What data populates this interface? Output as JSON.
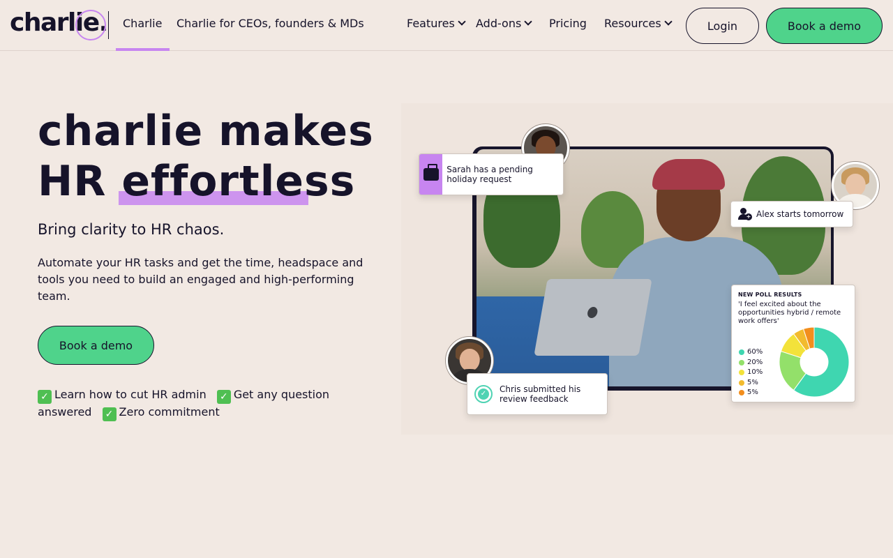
{
  "nav": {
    "logo_text": "charlie.",
    "links": {
      "charlie": "Charlie",
      "ceos": "Charlie for CEOs, founders & MDs",
      "features": "Features",
      "addons": "Add-ons",
      "pricing": "Pricing",
      "resources": "Resources"
    },
    "login_label": "Login",
    "demo_label": "Book a demo"
  },
  "hero": {
    "headline_line1": "charlie makes",
    "headline_line2_prefix": "HR ",
    "headline_line2_highlight": "effortless",
    "subtitle": "Bring clarity to HR chaos.",
    "body": "Automate your HR tasks and get the time, headspace and tools you need to build an engaged and high-performing team.",
    "cta_label": "Book a demo",
    "perks": [
      "Learn how to cut HR admin",
      "Get any question answered",
      "Zero commitment"
    ]
  },
  "illustration": {
    "holiday_card": "Sarah has a pending holiday request",
    "alex_card": "Alex starts tomorrow",
    "chris_card": "Chris submitted his review feedback",
    "poll": {
      "title": "NEW POLL RESULTS",
      "question": "'I feel excited about the opportunities hybrid / remote work offers'",
      "results": [
        {
          "label": "60%",
          "value": 60,
          "color": "#3fd6b0"
        },
        {
          "label": "20%",
          "value": 20,
          "color": "#93e06a"
        },
        {
          "label": "10%",
          "value": 10,
          "color": "#f3e23a"
        },
        {
          "label": "5%",
          "value": 5,
          "color": "#f2bb2e"
        },
        {
          "label": "5%",
          "value": 5,
          "color": "#f28e1d"
        }
      ]
    }
  },
  "colors": {
    "background": "#f2e9e3",
    "accent_purple": "#c785f0",
    "cta_green": "#4fd38b",
    "ink": "#16132a"
  }
}
